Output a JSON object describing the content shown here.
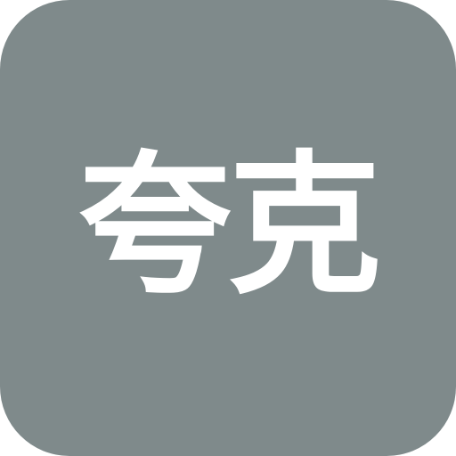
{
  "icon": {
    "label": "夸克",
    "background_color": "#7f8a8b",
    "text_color": "#ffffff"
  }
}
